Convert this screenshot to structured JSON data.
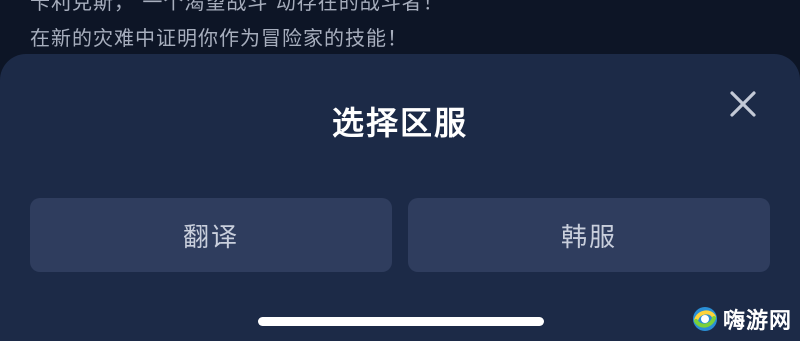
{
  "background": {
    "line1": "卡利克斯，  一个渴望战斗  动存在的战斗者！",
    "line2": "在新的灾难中证明你作为冒险家的技能！"
  },
  "dialog": {
    "title": "选择区服",
    "close_icon": "close-icon",
    "options": [
      {
        "label": "翻译"
      },
      {
        "label": "韩服"
      }
    ]
  },
  "watermark": {
    "text": "嗨游网"
  },
  "colors": {
    "screen_bg": "#0d1526",
    "sheet_bg": "#1c2a47",
    "option_bg": "#2f3d5e",
    "title_text": "#ffffff",
    "option_text": "#c9cfdc"
  }
}
